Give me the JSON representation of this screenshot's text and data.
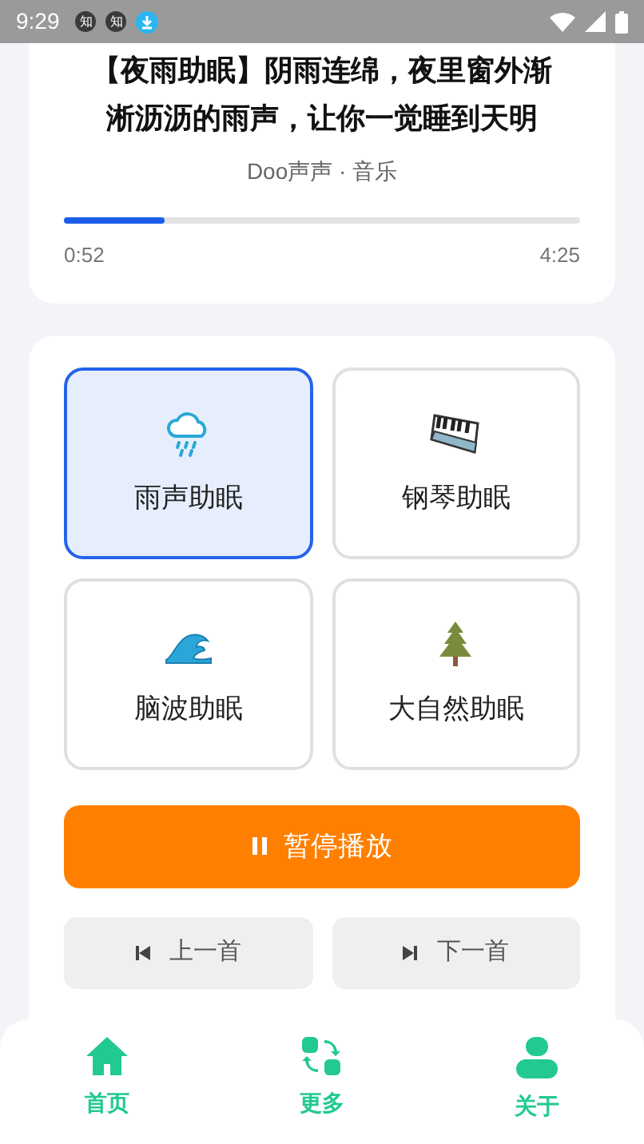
{
  "status_bar": {
    "time": "9:29",
    "notifications": [
      {
        "kind": "badge",
        "text": "知"
      },
      {
        "kind": "badge",
        "text": "知"
      },
      {
        "kind": "download"
      }
    ]
  },
  "track": {
    "title_lines": [
      "【夜雨助眠】阴雨连绵，夜里窗外渐",
      "淅沥沥的雨声，让你一觉睡到天明"
    ],
    "artist": "Doo声声 · 音乐",
    "progress": {
      "level": 0.196
    },
    "elapsed": "0:52",
    "duration": "4:25"
  },
  "modes": [
    {
      "kind": "rain",
      "label": "雨声助眠",
      "selected": true
    },
    {
      "kind": "piano",
      "label": "钢琴助眠",
      "selected": false
    },
    {
      "kind": "wave",
      "label": "脑波助眠",
      "selected": false
    },
    {
      "kind": "tree",
      "label": "大自然助眠",
      "selected": false
    }
  ],
  "play_button": {
    "label": "暂停播放",
    "playing": true
  },
  "prev_button": {
    "label": "上一首"
  },
  "next_button": {
    "label": "下一首"
  },
  "nav": [
    {
      "kind": "home",
      "label": "首页",
      "selected": true
    },
    {
      "kind": "more",
      "label": "更多",
      "selected": true
    },
    {
      "kind": "about",
      "label": "关于",
      "selected": true
    }
  ]
}
